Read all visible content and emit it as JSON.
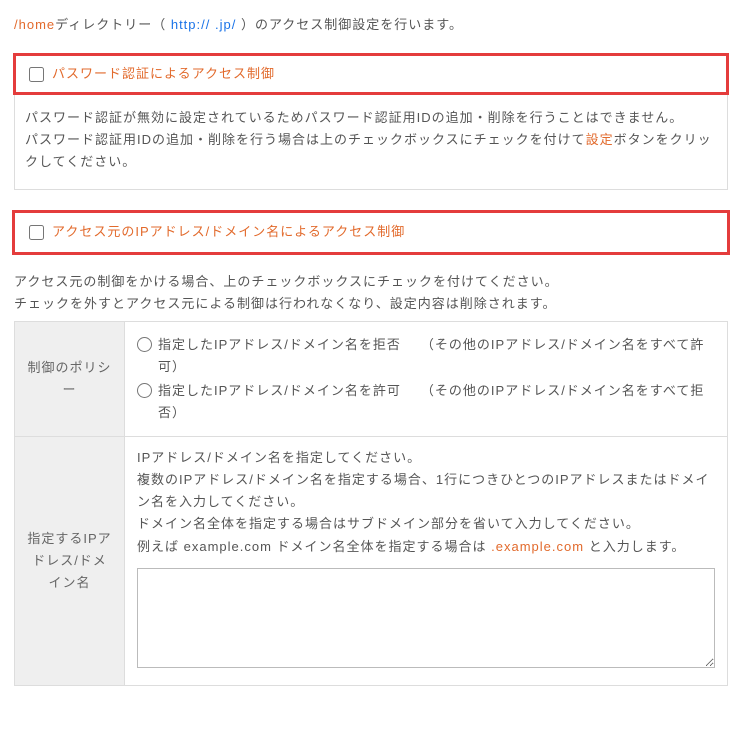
{
  "intro": {
    "p1": "/home",
    "p2": "ディレクトリー（ ",
    "p3": "http://",
    "p4": "                    .jp/",
    "p5": " ）のアクセス制御設定を行います。"
  },
  "section1": {
    "title": "パスワード認証によるアクセス制御",
    "body_a": "パスワード認証が無効に設定されているためパスワード認証用IDの追加・削除を行うことはできません。",
    "body_b1": "パスワード認証用IDの追加・削除を行う場合は上のチェックボックスにチェックを付けて",
    "body_b_link": "設定",
    "body_b2": "ボタンをクリックしてください。"
  },
  "section2": {
    "title": "アクセス元のIPアドレス/ドメイン名によるアクセス制御",
    "note1": "アクセス元の制御をかける場合、上のチェックボックスにチェックを付けてください。",
    "note2": "チェックを外すとアクセス元による制御は行われなくなり、設定内容は削除されます。",
    "row_policy_label": "制御のポリシー",
    "radio_deny_a": "指定したIPアドレス/ドメイン名を拒否",
    "radio_deny_b": "（その他のIPアドレス/ドメイン名をすべて許可）",
    "radio_allow_a": "指定したIPアドレス/ドメイン名を許可",
    "radio_allow_b": "（その他のIPアドレス/ドメイン名をすべて拒否）",
    "row_ip_label": "指定するIPアドレス/ドメイン名",
    "ip_help1": "IPアドレス/ドメイン名を指定してください。",
    "ip_help2": "複数のIPアドレス/ドメイン名を指定する場合、1行につきひとつのIPアドレスまたはドメイン名を入力してください。",
    "ip_help3": "ドメイン名全体を指定する場合はサブドメイン部分を省いて入力してください。",
    "ip_help4a": "例えば example.com ドメイン名全体を指定する場合は ",
    "ip_help4b": ".example.com",
    "ip_help4c": " と入力します。"
  }
}
